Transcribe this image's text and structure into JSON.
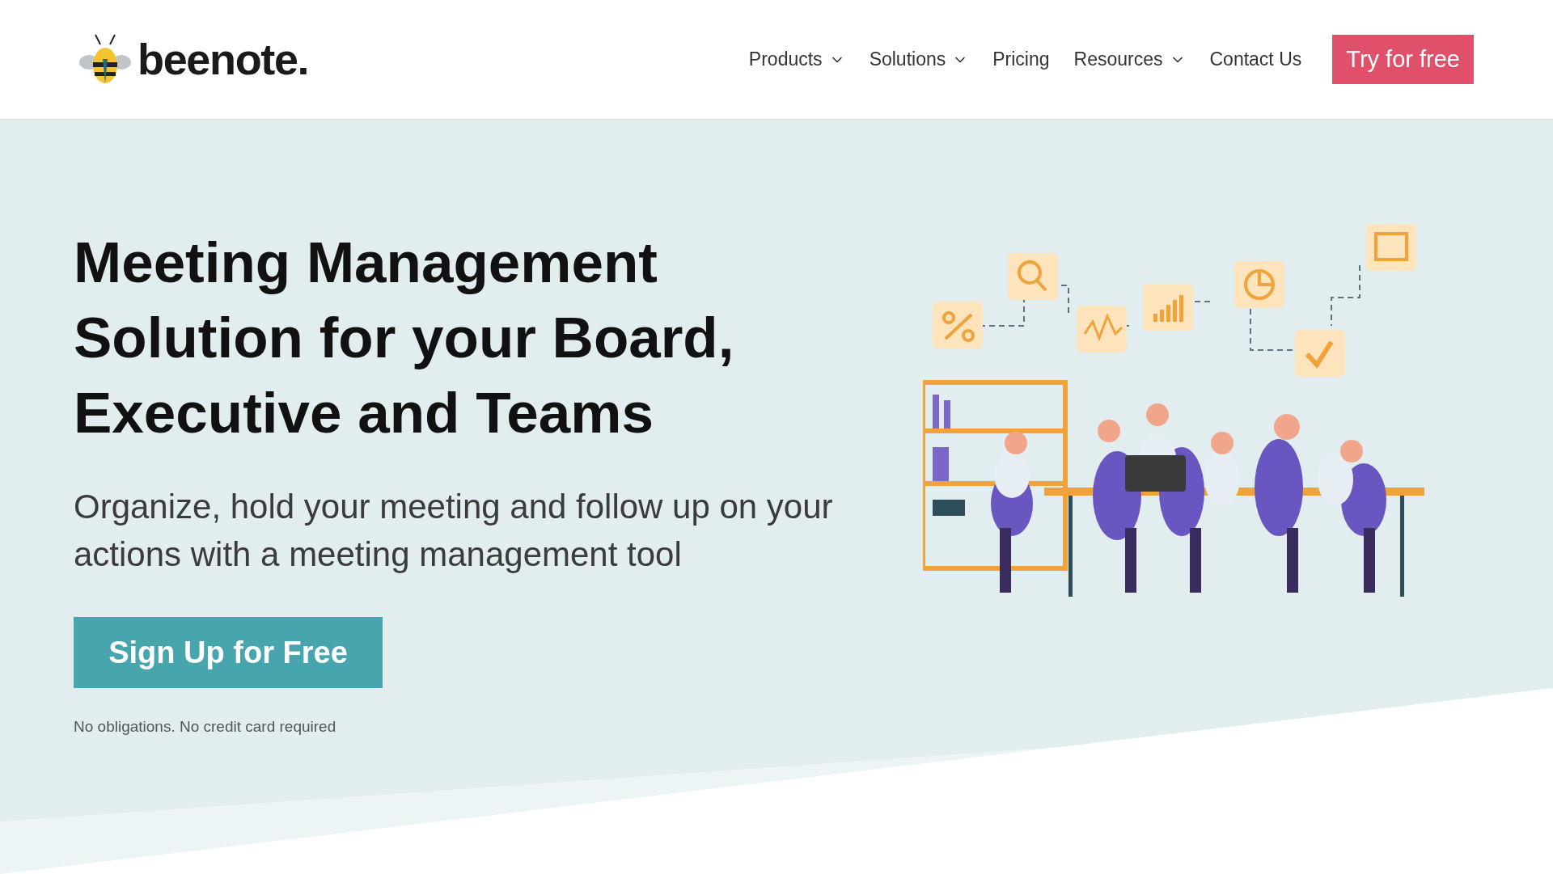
{
  "header": {
    "logo": {
      "text": "beenote."
    },
    "nav": [
      {
        "label": "Products",
        "kind": "dropdown"
      },
      {
        "label": "Solutions",
        "kind": "dropdown"
      },
      {
        "label": "Pricing",
        "kind": "link"
      },
      {
        "label": "Resources",
        "kind": "dropdown"
      },
      {
        "label": "Contact Us",
        "kind": "link"
      }
    ],
    "cta": "Try for free"
  },
  "hero": {
    "title": "Meeting Management Solution for your Board, Executive and Teams",
    "subtitle": "Organize, hold your meeting and follow up on your actions with a meeting management tool",
    "button": "Sign Up for Free",
    "note": "No obligations. No credit card required"
  }
}
